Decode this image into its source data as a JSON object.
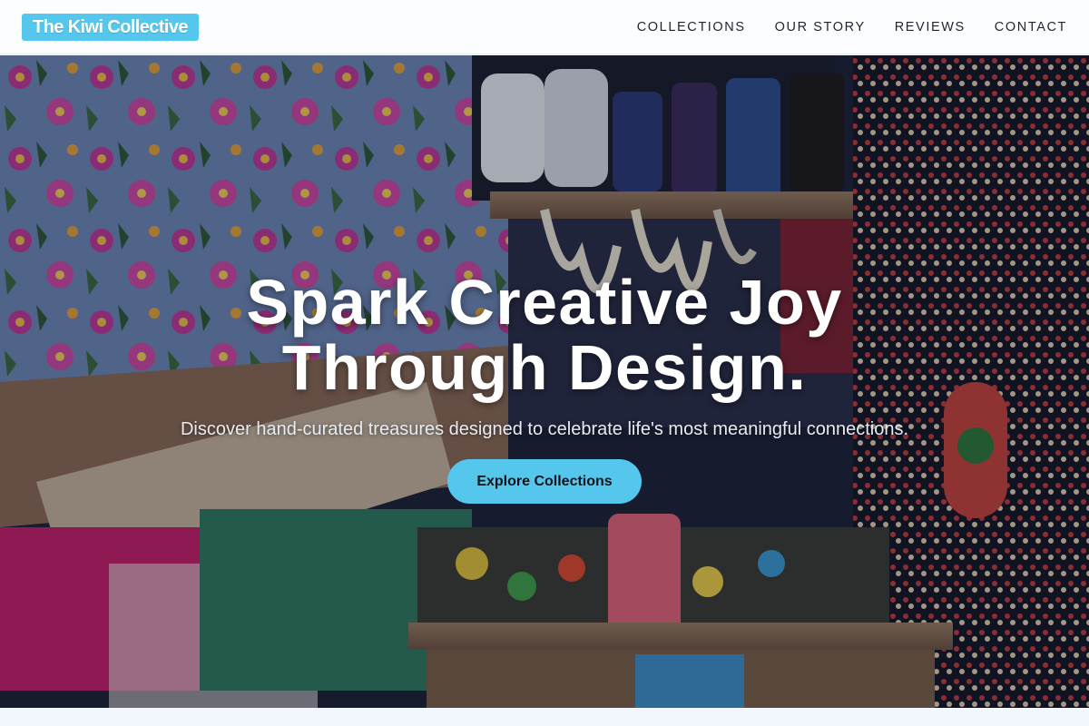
{
  "brand": {
    "logo_text": "The Kiwi Collective",
    "accent_color": "#55c7ec"
  },
  "nav": {
    "items": [
      {
        "label": "COLLECTIONS"
      },
      {
        "label": "OUR STORY"
      },
      {
        "label": "REVIEWS"
      },
      {
        "label": "CONTACT"
      }
    ]
  },
  "hero": {
    "title_line1": "Spark Creative Joy",
    "title_line2": "Through Design.",
    "subtitle": "Discover hand-curated treasures designed to celebrate life's most meaningful connections.",
    "cta_label": "Explore Collections",
    "background_image": "market-stall-photo"
  }
}
